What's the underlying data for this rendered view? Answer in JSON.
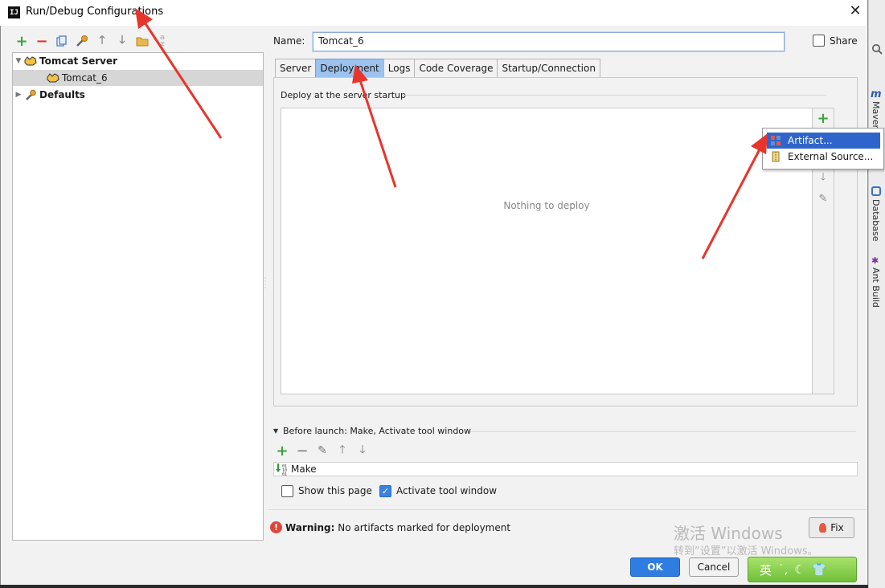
{
  "window": {
    "title": "Run/Debug Configurations",
    "close_glyph": "✕"
  },
  "toolbar": {
    "icons": [
      "add-icon",
      "remove-icon",
      "copy-icon",
      "edit-defaults-icon",
      "move-up-icon",
      "move-down-icon",
      "folder-icon",
      "sort-icon"
    ]
  },
  "tree": {
    "items": [
      {
        "label": "Tomcat Server",
        "level": 0,
        "expanded": true,
        "bold": true
      },
      {
        "label": "Tomcat_6",
        "level": 1,
        "selected": true
      },
      {
        "label": "Defaults",
        "level": 0,
        "expanded": false,
        "bold": true
      }
    ]
  },
  "name": {
    "label": "Name:",
    "value": "Tomcat_6"
  },
  "share": {
    "label": "Share",
    "checked": false
  },
  "tabs": [
    {
      "label": "Server"
    },
    {
      "label": "Deployment",
      "active": true
    },
    {
      "label": "Logs"
    },
    {
      "label": "Code Coverage"
    },
    {
      "label": "Startup/Connection"
    }
  ],
  "deployment": {
    "section_title": "Deploy at the server startup",
    "empty_text": "Nothing to deploy"
  },
  "popup": {
    "items": [
      {
        "label": "Artifact...",
        "selected": true
      },
      {
        "label": "External Source..."
      }
    ]
  },
  "before_launch": {
    "title": "Before launch: Make, Activate tool window",
    "tasks": [
      {
        "label": "Make"
      }
    ],
    "show_this_page": {
      "label": "Show this page",
      "checked": false
    },
    "activate_tool_window": {
      "label": "Activate tool window",
      "checked": true
    }
  },
  "warning": {
    "prefix": "Warning:",
    "message": "No artifacts marked for deployment"
  },
  "buttons": {
    "fix": "Fix",
    "ok": "OK",
    "cancel": "Cancel"
  },
  "side_panel": {
    "maven": "Maven",
    "database": "Database",
    "ant_build": "Ant Build",
    "maven_glyph": "m"
  },
  "watermark": {
    "line1": "激活 Windows",
    "line2": "转到“设置”以激活 Windows。"
  },
  "ime": {
    "label": "英"
  },
  "colors": {
    "accent": "#2f7de1",
    "active_tab": "#9cc3ef",
    "popup_selection": "#2f65ca",
    "annotation_arrow": "#e8352b"
  }
}
